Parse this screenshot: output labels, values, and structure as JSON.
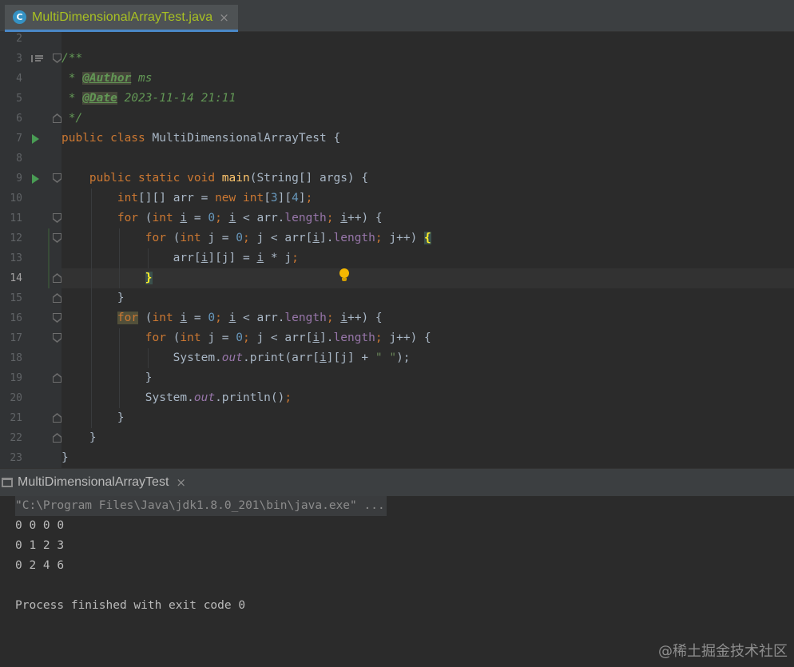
{
  "editor_tab": {
    "icon": "java-class-icon",
    "icon_glyph": "C",
    "label": "MultiDimensionalArrayTest.java",
    "close": "×"
  },
  "gutter": {
    "line_numbers": [
      "2",
      "3",
      "4",
      "5",
      "6",
      "7",
      "8",
      "9",
      "10",
      "11",
      "12",
      "13",
      "14",
      "15",
      "16",
      "17",
      "18",
      "19",
      "20",
      "21",
      "22",
      "23"
    ],
    "current_line": "14"
  },
  "code": {
    "l2": "",
    "l3": {
      "a": "/**"
    },
    "l4": {
      "a": " * ",
      "b": "@Author",
      "c": " ms"
    },
    "l5": {
      "a": " * ",
      "b": "@Date",
      "c": " 2023-11-14 21:11"
    },
    "l6": {
      "a": " */"
    },
    "l7": {
      "a": "public class ",
      "b": "MultiDimensionalArrayTest {"
    },
    "l9": {
      "a": "    public static void ",
      "b": "main",
      "c": "(String[] args) {"
    },
    "l10": {
      "a": "        ",
      "b": "int",
      "c": "[][] arr = ",
      "d": "new int",
      "e": "[",
      "f": "3",
      "g": "][",
      "h": "4",
      "i": "]",
      "j": ";"
    },
    "l11": {
      "a": "        ",
      "b": "for ",
      "c": "(",
      "d": "int ",
      "e": "i",
      "f": " = ",
      "g": "0",
      "h": "; ",
      "i": "i",
      "j": " < arr.",
      "k": "length",
      "l": "; ",
      "m": "i",
      "n": "++) {"
    },
    "l12": {
      "a": "            ",
      "b": "for ",
      "c": "(",
      "d": "int ",
      "e": "j = ",
      "f": "0",
      "g": "; ",
      "h": "j < arr[",
      "i": "i",
      "j": "].",
      "k": "length",
      "l": "; ",
      "m": "j++) ",
      "n": "{"
    },
    "l13": {
      "a": "                arr[",
      "b": "i",
      "c": "][j] = ",
      "d": "i",
      "e": " * j",
      "f": ";"
    },
    "l14": {
      "a": "            ",
      "b": "}"
    },
    "l15": {
      "a": "        }"
    },
    "l16": {
      "a": "        ",
      "b": "for",
      "c": " (",
      "d": "int ",
      "e": "i",
      "f": " = ",
      "g": "0",
      "h": "; ",
      "i": "i",
      "j": " < arr.",
      "k": "length",
      "l": "; ",
      "m": "i",
      "n": "++) {"
    },
    "l17": {
      "a": "            ",
      "b": "for ",
      "c": "(",
      "d": "int ",
      "e": "j = ",
      "f": "0",
      "g": "; ",
      "h": "j < arr[",
      "i": "i",
      "j": "].",
      "k": "length",
      "l": "; ",
      "m": "j++) {"
    },
    "l18": {
      "a": "                System.",
      "b": "out",
      "c": ".print(arr[",
      "d": "i",
      "e": "][j] + ",
      "f": "\" \"",
      "g": ");"
    },
    "l19": {
      "a": "            }"
    },
    "l20": {
      "a": "            System.",
      "b": "out",
      "c": ".println()",
      "d": ";"
    },
    "l21": {
      "a": "        }"
    },
    "l22": {
      "a": "    }"
    },
    "l23": {
      "a": "}"
    }
  },
  "run_panel": {
    "tab_icon": "console-icon",
    "tab_label": "MultiDimensionalArrayTest",
    "close": "×",
    "output": [
      "\"C:\\Program Files\\Java\\jdk1.8.0_201\\bin\\java.exe\" ...",
      "0 0 0 0",
      "0 1 2 3",
      "0 2 4 6",
      "",
      "Process finished with exit code 0"
    ]
  },
  "watermark": "@稀土掘金技术社区",
  "colors": {
    "keyword": "#CC7832",
    "comment": "#629755",
    "number": "#6897BB",
    "method": "#FFC66D",
    "field": "#9876AA",
    "string": "#6A8759",
    "text": "#A9B7C6"
  }
}
